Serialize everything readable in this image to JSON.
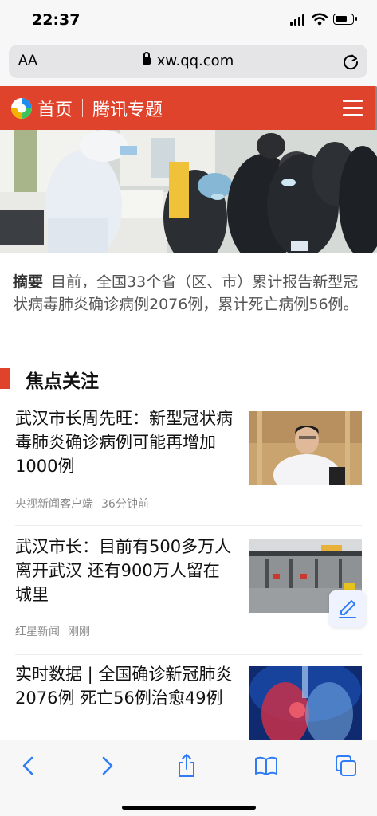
{
  "status_bar": {
    "time": "22:37"
  },
  "browser": {
    "aa_label": "AA",
    "url": "xw.qq.com"
  },
  "site_header": {
    "home_label": "首页",
    "channel_label": "腾讯专题"
  },
  "summary": {
    "label": "摘要",
    "text": "目前，全国33个省（区、市）累计报告新型冠状病毒肺炎确诊病例2076例，累计死亡病例56例。"
  },
  "section": {
    "title": "焦点关注"
  },
  "articles": [
    {
      "title": "武汉市长周先旺：新型冠状病毒肺炎确诊病例可能再增加1000例",
      "source": "央视新闻客户端",
      "time": "36分钟前"
    },
    {
      "title": "武汉市长：目前有500多万人离开武汉 还有900万人留在城里",
      "source": "红星新闻",
      "time": "刚刚"
    },
    {
      "title": "实时数据 | 全国确诊新冠肺炎2076例 死亡56例治愈49例",
      "source": "",
      "time": ""
    }
  ],
  "colors": {
    "brand_red": "#e0432c",
    "ios_blue": "#2f7cf6",
    "meta_gray": "#8a8a8a"
  },
  "icons": {
    "toolbar": [
      "back-icon",
      "forward-icon",
      "share-icon",
      "bookmarks-icon",
      "tabs-icon"
    ]
  }
}
